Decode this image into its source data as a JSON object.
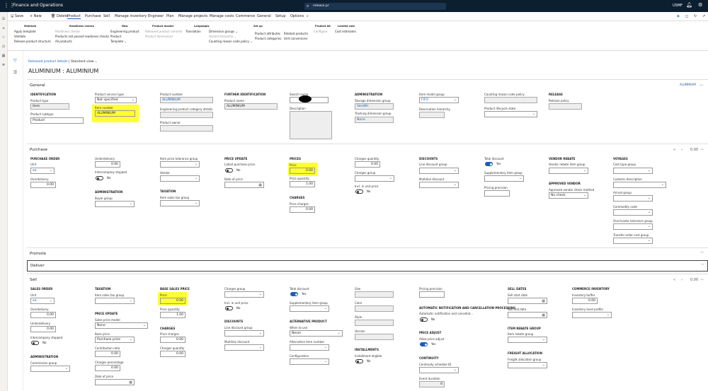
{
  "app": {
    "title": "Finance and Operations",
    "search_value": "release pr",
    "company": "USMF"
  },
  "actions": [
    "Save",
    "New",
    "Delete",
    "Product",
    "Purchase",
    "Sell",
    "Manage inventory",
    "Engineer",
    "Plan",
    "Manage projects",
    "Manage costs",
    "Commerce",
    "General",
    "Setup",
    "Options"
  ],
  "ribbon": {
    "maintain": {
      "title": "Maintain",
      "items": [
        "Apply template",
        "Validate",
        "Release product structure"
      ]
    },
    "readiness": {
      "title": "Readiness checks",
      "items": [
        "Readiness checks",
        "Products not passed readiness checks",
        "All products"
      ]
    },
    "new": {
      "title": "New",
      "items": [
        "Engineering product",
        "Product",
        "Template"
      ]
    },
    "master": {
      "title": "Product master",
      "items": [
        "Released product variants",
        "Product dimensions"
      ]
    },
    "languages": {
      "title": "Languages",
      "items": [
        "Translation"
      ]
    },
    "setup": {
      "title": "Set up",
      "items": [
        "Dimension groups",
        "Variant hierarchy",
        "Counting reason code policy",
        "Product attributes",
        "Product categories",
        "Related products",
        "Unit conversions"
      ]
    },
    "kit": {
      "title": "Product kit",
      "items": [
        "Configure"
      ]
    },
    "landed": {
      "title": "Landed cost",
      "items": [
        "Cost estimates"
      ]
    }
  },
  "page": {
    "breadcrumb": "Released product details",
    "view": "Standard view",
    "title": "ALUMINIUM : ALUMINIUM"
  },
  "general": {
    "header": "General",
    "right_label": "ALUMINIUM",
    "identification": "IDENTIFICATION",
    "product_type_lbl": "Product type",
    "product_type": "Item",
    "subtype_lbl": "Product subtype",
    "subtype": "Product",
    "service_lbl": "Product service type",
    "service": "Not specified",
    "item_number_lbl": "Item number",
    "item_number": "ALUMINIUM",
    "product_number_lbl": "Product number",
    "product_number": "ALUMINIUM",
    "eng_lbl": "Engineering product category details",
    "owner_lbl": "Product owner",
    "further": "FURTHER IDENTIFICATION",
    "product_name_lbl": "Product name",
    "product_name": "ALUMINIUM",
    "search_name_lbl": "Search name",
    "description_lbl": "Description",
    "administration": "ADMINISTRATION",
    "storage_lbl": "Storage dimension group",
    "storage": "SiteWH",
    "tracking_lbl": "Tracking dimension group",
    "tracking": "None",
    "item_model_lbl": "Item model group",
    "item_model": "FIFO",
    "reservation_lbl": "Reservation hierarchy",
    "counting_lbl": "Counting reason code policy",
    "lifecycle_lbl": "Product lifecycle state",
    "release": "RELEASE",
    "release_policy_lbl": "Release policy"
  },
  "purchase": {
    "header": "Purchase",
    "nav": "0.00",
    "order": "PURCHASE ORDER",
    "unit_lbl": "Unit",
    "unit": "ea",
    "over_lbl": "Overdelivery",
    "over": "0.00",
    "under_lbl": "Underdelivery",
    "under": "0.00",
    "interco_lbl": "Intercompany stopped",
    "interco": "No",
    "admin": "ADMINISTRATION",
    "buyer_lbl": "Buyer group",
    "tolerance_lbl": "Item price tolerance group",
    "vendor_lbl": "Vendor",
    "taxation": "TAXATION",
    "tax_lbl": "Item sales tax group",
    "price_update": "PRICE UPDATE",
    "latest_lbl": "Latest purchase price",
    "latest": "No",
    "date_lbl": "Date of price",
    "prices": "PRICES",
    "price_lbl": "Price",
    "price": "0.00",
    "qty_lbl": "Price quantity",
    "qty": "1.00",
    "charges": "CHARGES",
    "charges_lbl": "Price charges",
    "charges_val": "0.00",
    "cqty_lbl": "Charges quantity",
    "cqty": "0.00",
    "cgroup_lbl": "Charges group",
    "incl_lbl": "Incl. in unit price",
    "incl": "No",
    "discounts": "DISCOUNTS",
    "line_lbl": "Line discount group",
    "multi_lbl": "Multiline discount",
    "total_lbl": "Total discount",
    "total": "Yes",
    "supp_lbl": "Supplementary item group",
    "precision_lbl": "Pricing precision",
    "rebate": "VENDOR REBATE",
    "rebate_lbl": "Vendor rebate item group",
    "approved": "APPROVED VENDOR",
    "approved_lbl": "Approved vendor check method",
    "approved_val": "No check",
    "voyages": "VOYAGES",
    "cost_lbl": "Cost type group",
    "customs_lbl": "Customs description",
    "arrival_lbl": "Arrival group",
    "commodity_lbl": "Commodity code",
    "overunder_lbl": "Over/under tolerance group",
    "transfer_lbl": "Transfer order cost group"
  },
  "promote": {
    "header": "Promote"
  },
  "deliver": {
    "header": "Deliver"
  },
  "sell": {
    "header": "Sell",
    "nav": "0.00",
    "order": "SALES ORDER",
    "unit_lbl": "Unit",
    "unit": "ea",
    "over_lbl": "Overdelivery",
    "over": "0.00",
    "under_lbl": "Underdelivery",
    "under": "0.00",
    "interco_lbl": "Intercompany stopped",
    "interco": "No",
    "admin": "ADMINISTRATION",
    "commission_lbl": "Commission group",
    "taxation": "TAXATION",
    "tax_lbl": "Item sales tax group",
    "price_update": "PRICE UPDATE",
    "model_lbl": "Sales price model",
    "model": "None",
    "base_lbl": "Base price",
    "base": "Purchase price",
    "contrib_lbl": "Contribution ratio",
    "contrib": "0.00",
    "charges_pct_lbl": "Charges percentage",
    "charges_pct": "0.00",
    "date_lbl": "Date of price",
    "base_sales": "BASE SALES PRICE",
    "price_lbl": "Price",
    "price": "0.00",
    "qty_lbl": "Price quantity",
    "qty": "1.00",
    "charges": "CHARGES",
    "pcharges_lbl": "Price charges",
    "pcharges": "0.00",
    "cqty_lbl": "Charges quantity",
    "cqty": "0.00",
    "cgroup_lbl": "Charges group",
    "incl_lbl": "Incl. in unit price",
    "incl": "No",
    "discounts": "DISCOUNTS",
    "line_lbl": "Line discount group",
    "multi_lbl": "Multiline discount",
    "total_lbl": "Total discount",
    "total": "Yes",
    "supp_lbl": "Supplementary item group",
    "alt": "ALTERNATIVE PRODUCT",
    "when_lbl": "When to use",
    "when": "Never",
    "alt_item_lbl": "Alternative item number",
    "config_lbl": "Configuration",
    "size_lbl": "Size",
    "color_lbl": "Color",
    "style_lbl": "Style",
    "version_lbl": "Version",
    "installments": "INSTALLMENTS",
    "eligible_lbl": "Installment eligible",
    "eligible": "No",
    "precision_lbl": "Pricing precision",
    "auto": "AUTOMATIC NOTIFICATION AND CANCELLATION PROCESSING",
    "auto_lbl": "Automatic notification and cancellat...",
    "auto_val": "No",
    "adjust": "PRICE ADJUST",
    "allow_lbl": "Allow price adjust",
    "allow": "Yes",
    "continuity": "CONTINUITY",
    "schedule_lbl": "Continuity schedule ID",
    "event_lbl": "Event duration",
    "event": "0",
    "dates": "SELL DATES",
    "start_lbl": "Sell start date",
    "end_lbl": "Sell end date",
    "rebate": "ITEM REBATE GROUP",
    "rebate_lbl": "Item rebate group",
    "freight": "FREIGHT ALLOCATION",
    "freight_lbl": "Freight allocation group",
    "commerce": "COMMERCE INVENTORY",
    "buffer_lbl": "Inventory buffer",
    "buffer": "0.00",
    "level_lbl": "Inventory level profile"
  },
  "colors": {
    "topbar": "#0c1f30",
    "accent": "#1a5fb4",
    "highlight": "#ffff33"
  }
}
